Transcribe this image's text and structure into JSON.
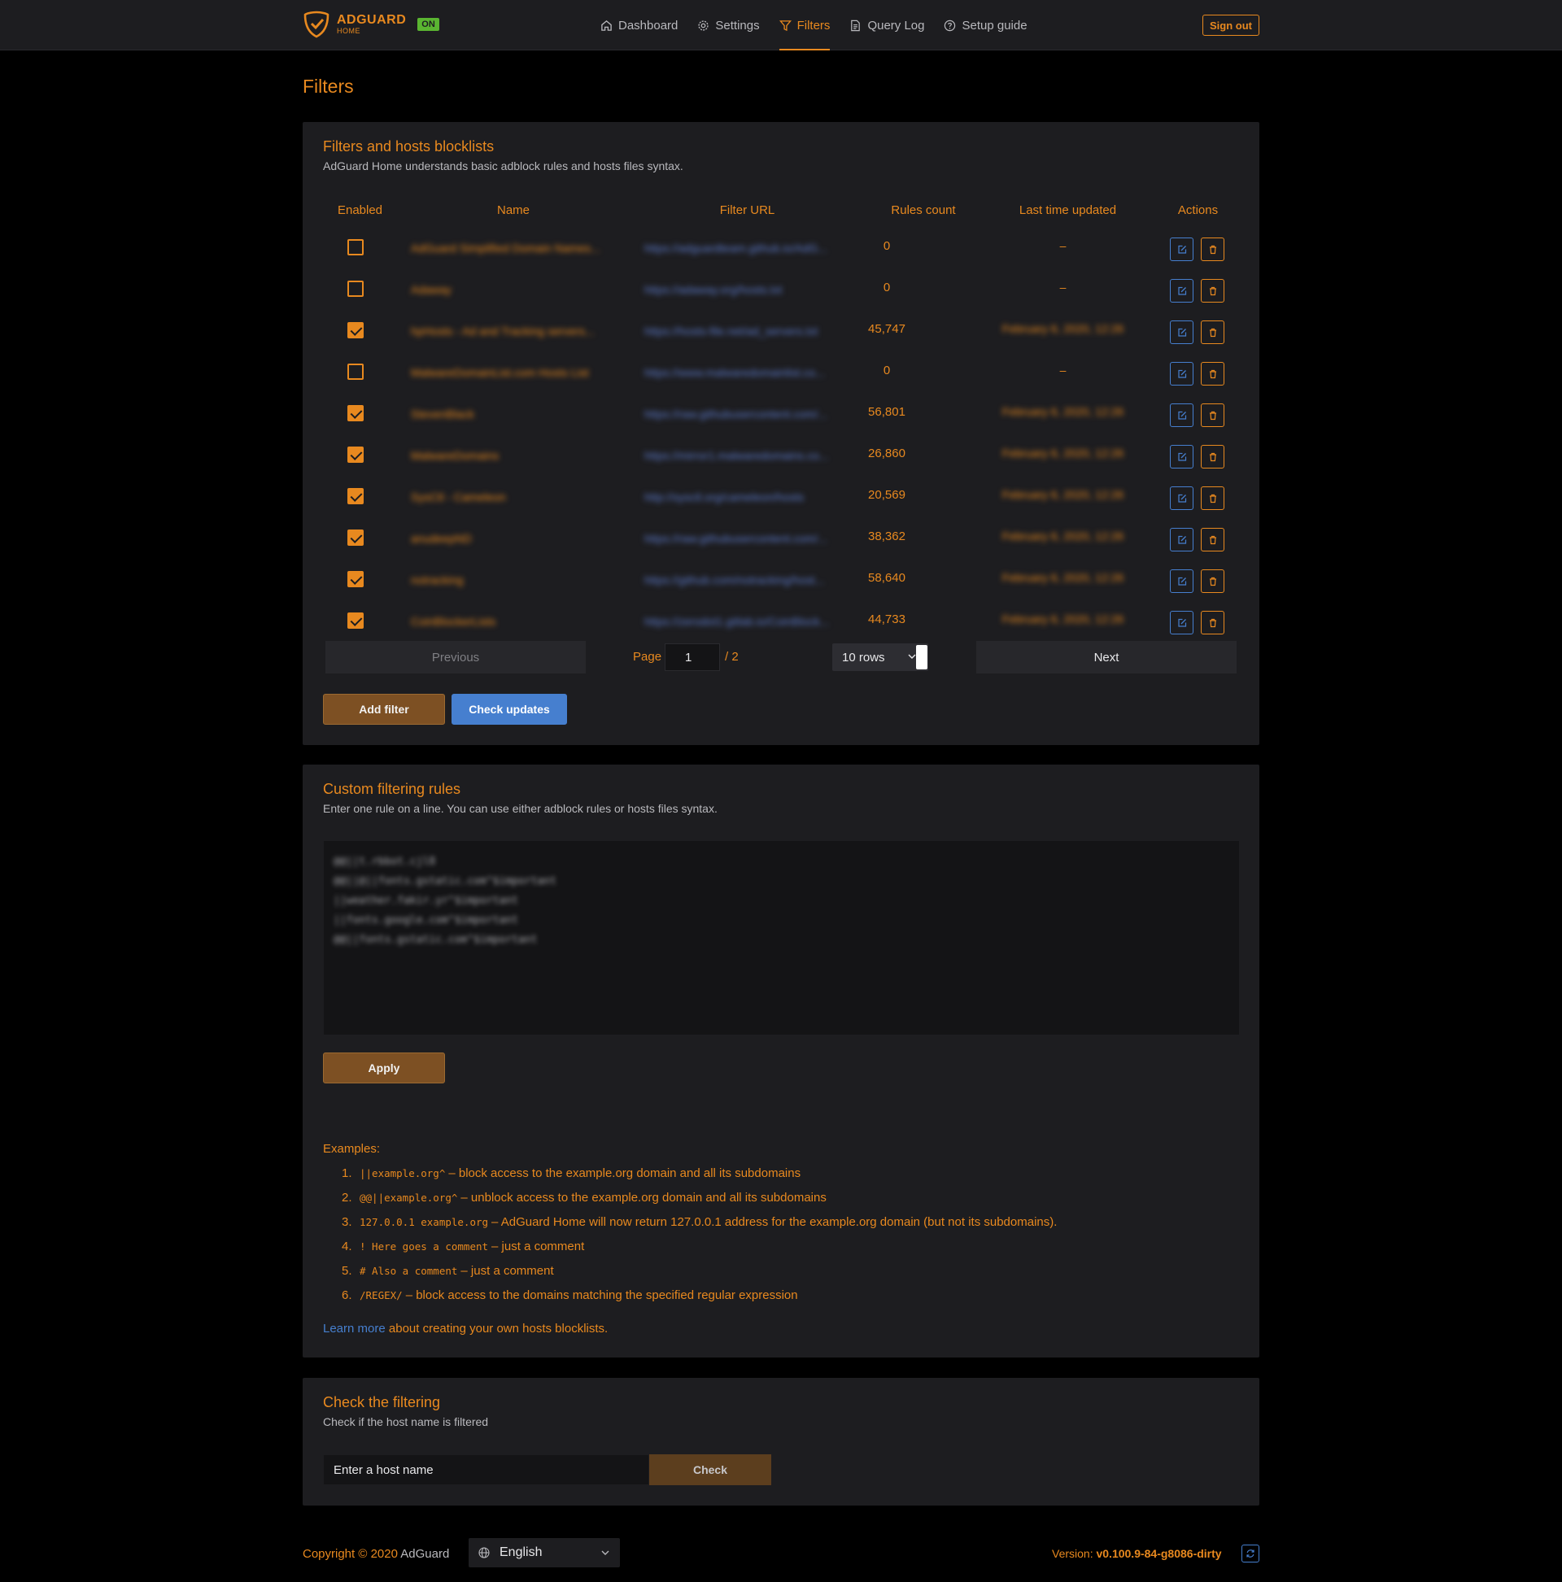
{
  "brand": {
    "name": "ADGUARD",
    "sub": "HOME",
    "status": "ON"
  },
  "nav": [
    {
      "label": "Dashboard",
      "icon": "home-icon",
      "active": false
    },
    {
      "label": "Settings",
      "icon": "gear-icon",
      "active": false
    },
    {
      "label": "Filters",
      "icon": "filter-icon",
      "active": true
    },
    {
      "label": "Query Log",
      "icon": "document-icon",
      "active": false
    },
    {
      "label": "Setup guide",
      "icon": "help-circle-icon",
      "active": false
    }
  ],
  "header": {
    "signout": "Sign out"
  },
  "page_title": "Filters",
  "blocklists": {
    "title": "Filters and hosts blocklists",
    "subtitle": "AdGuard Home understands basic adblock rules and hosts files syntax.",
    "columns": [
      "Enabled",
      "Name",
      "Filter URL",
      "Rules count",
      "Last time updated",
      "Actions"
    ],
    "rows": [
      {
        "enabled": false,
        "name": "AdGuard Simplified Domain Names...",
        "url": "https://adguardteam.github.io/AdG...",
        "count": "0",
        "updated": "–"
      },
      {
        "enabled": false,
        "name": "Adaway",
        "url": "https://adaway.org/hosts.txt",
        "count": "0",
        "updated": "–"
      },
      {
        "enabled": true,
        "name": "hpHosts - Ad and Tracking servers...",
        "url": "https://hosts-file.net/ad_servers.txt",
        "count": "45,747",
        "updated": "February 6, 2020, 12:26"
      },
      {
        "enabled": false,
        "name": "MalwareDomainList.com Hosts List",
        "url": "https://www.malwaredomainlist.co...",
        "count": "0",
        "updated": "–"
      },
      {
        "enabled": true,
        "name": "StevenBlack",
        "url": "https://raw.githubusercontent.com/...",
        "count": "56,801",
        "updated": "February 6, 2020, 12:26"
      },
      {
        "enabled": true,
        "name": "MalwareDomains",
        "url": "https://mirror1.malwaredomains.co...",
        "count": "26,860",
        "updated": "February 6, 2020, 12:26"
      },
      {
        "enabled": true,
        "name": "SysCtl - Cameleon",
        "url": "http://sysctl.org/cameleon/hosts",
        "count": "20,569",
        "updated": "February 6, 2020, 12:26"
      },
      {
        "enabled": true,
        "name": "anudeepND",
        "url": "https://raw.githubusercontent.com/...",
        "count": "38,362",
        "updated": "February 6, 2020, 12:26"
      },
      {
        "enabled": true,
        "name": "notracking",
        "url": "https://github.com/notracking/host...",
        "count": "58,640",
        "updated": "February 6, 2020, 12:26"
      },
      {
        "enabled": true,
        "name": "CoinBlockerLists",
        "url": "https://zerodot1.gitlab.io/CoinBlock...",
        "count": "44,733",
        "updated": "February 6, 2020, 12:26"
      }
    ],
    "pagination": {
      "previous": "Previous",
      "next": "Next",
      "page_label": "Page",
      "page": "1",
      "total": "/ 2",
      "rows": "10 rows"
    },
    "add_filter": "Add filter",
    "check_updates": "Check updates"
  },
  "custom_rules": {
    "title": "Custom filtering rules",
    "subtitle": "Enter one rule on a line. You can use either adblock rules or hosts files syntax.",
    "lines": [
      "@@||t.rbbot.cjl8",
      "@@||@||fonts.gstatic.com^$important",
      "||weather.fakir.yr^$important",
      "||fonts.google.com^$important",
      "@@||fonts.gstatic.com^$important"
    ],
    "apply": "Apply",
    "examples_title": "Examples:",
    "examples": [
      {
        "num": "1.",
        "code": "||example.org^",
        "text": "– block access to the example.org domain and all its subdomains"
      },
      {
        "num": "2.",
        "code": "@@||example.org^",
        "text": "– unblock access to the example.org domain and all its subdomains"
      },
      {
        "num": "3.",
        "code": "127.0.0.1 example.org",
        "text": "– AdGuard Home will now return 127.0.0.1 address for the example.org domain (but not its subdomains)."
      },
      {
        "num": "4.",
        "code": "! Here goes a comment",
        "text": "– just a comment"
      },
      {
        "num": "5.",
        "code": "# Also a comment",
        "text": "– just a comment"
      },
      {
        "num": "6.",
        "code": "/REGEX/",
        "text": "– block access to the domains matching the specified regular expression"
      }
    ],
    "learn_link": "Learn more",
    "learn_rest": " about creating your own hosts blocklists."
  },
  "check_filtering": {
    "title": "Check the filtering",
    "subtitle": "Check if the host name is filtered",
    "placeholder": "Enter a host name",
    "button": "Check"
  },
  "footer": {
    "copyright": "Copyright © 2020 ",
    "brand": "AdGuard",
    "language": "English",
    "version_label": "Version: ",
    "version": "v0.100.9-84-g8086-dirty"
  },
  "colors": {
    "accent": "#e8891f",
    "blue": "#467fcf",
    "card": "#1d1d20",
    "header": "#1d1d20"
  }
}
